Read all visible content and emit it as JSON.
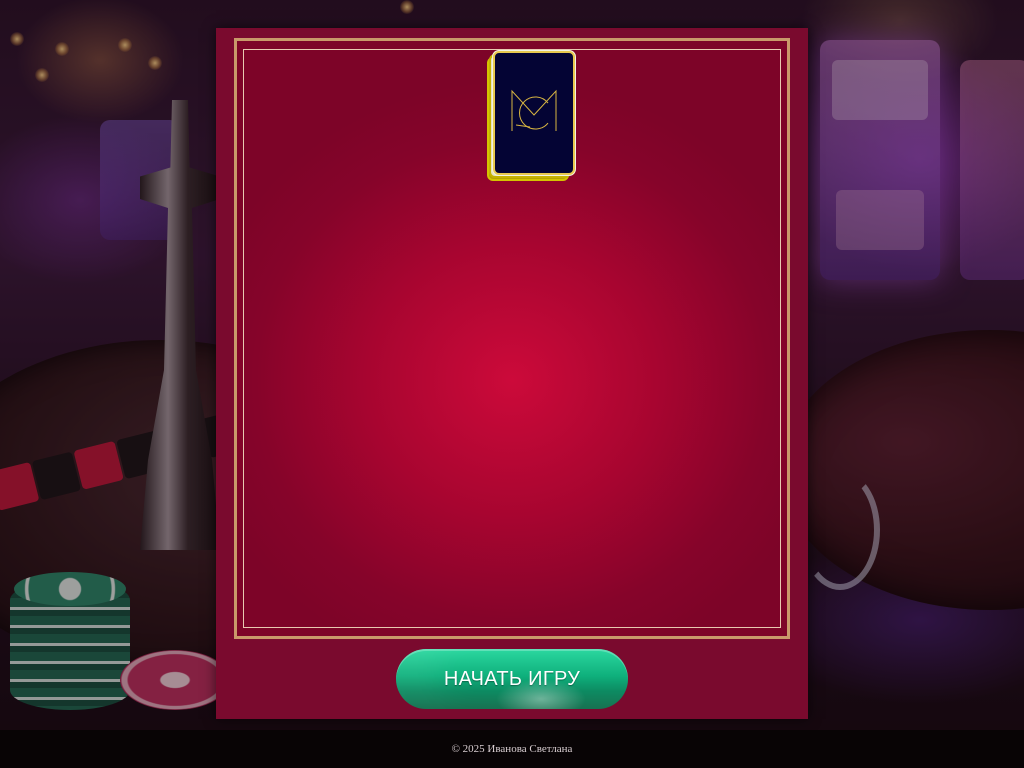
{
  "game": {
    "start_button_label": "НАЧАТЬ ИГРУ",
    "deck_icon": "deck-logo-icon"
  },
  "footer": {
    "copyright": "© 2025 Иванова Светлана"
  },
  "colors": {
    "panel": "#7a0a2e",
    "felt_center": "#cc0a3a",
    "felt_border": "#c9996a",
    "card_back": "#040434",
    "card_edge": "#e7c94e",
    "button": "#0fb07c"
  }
}
